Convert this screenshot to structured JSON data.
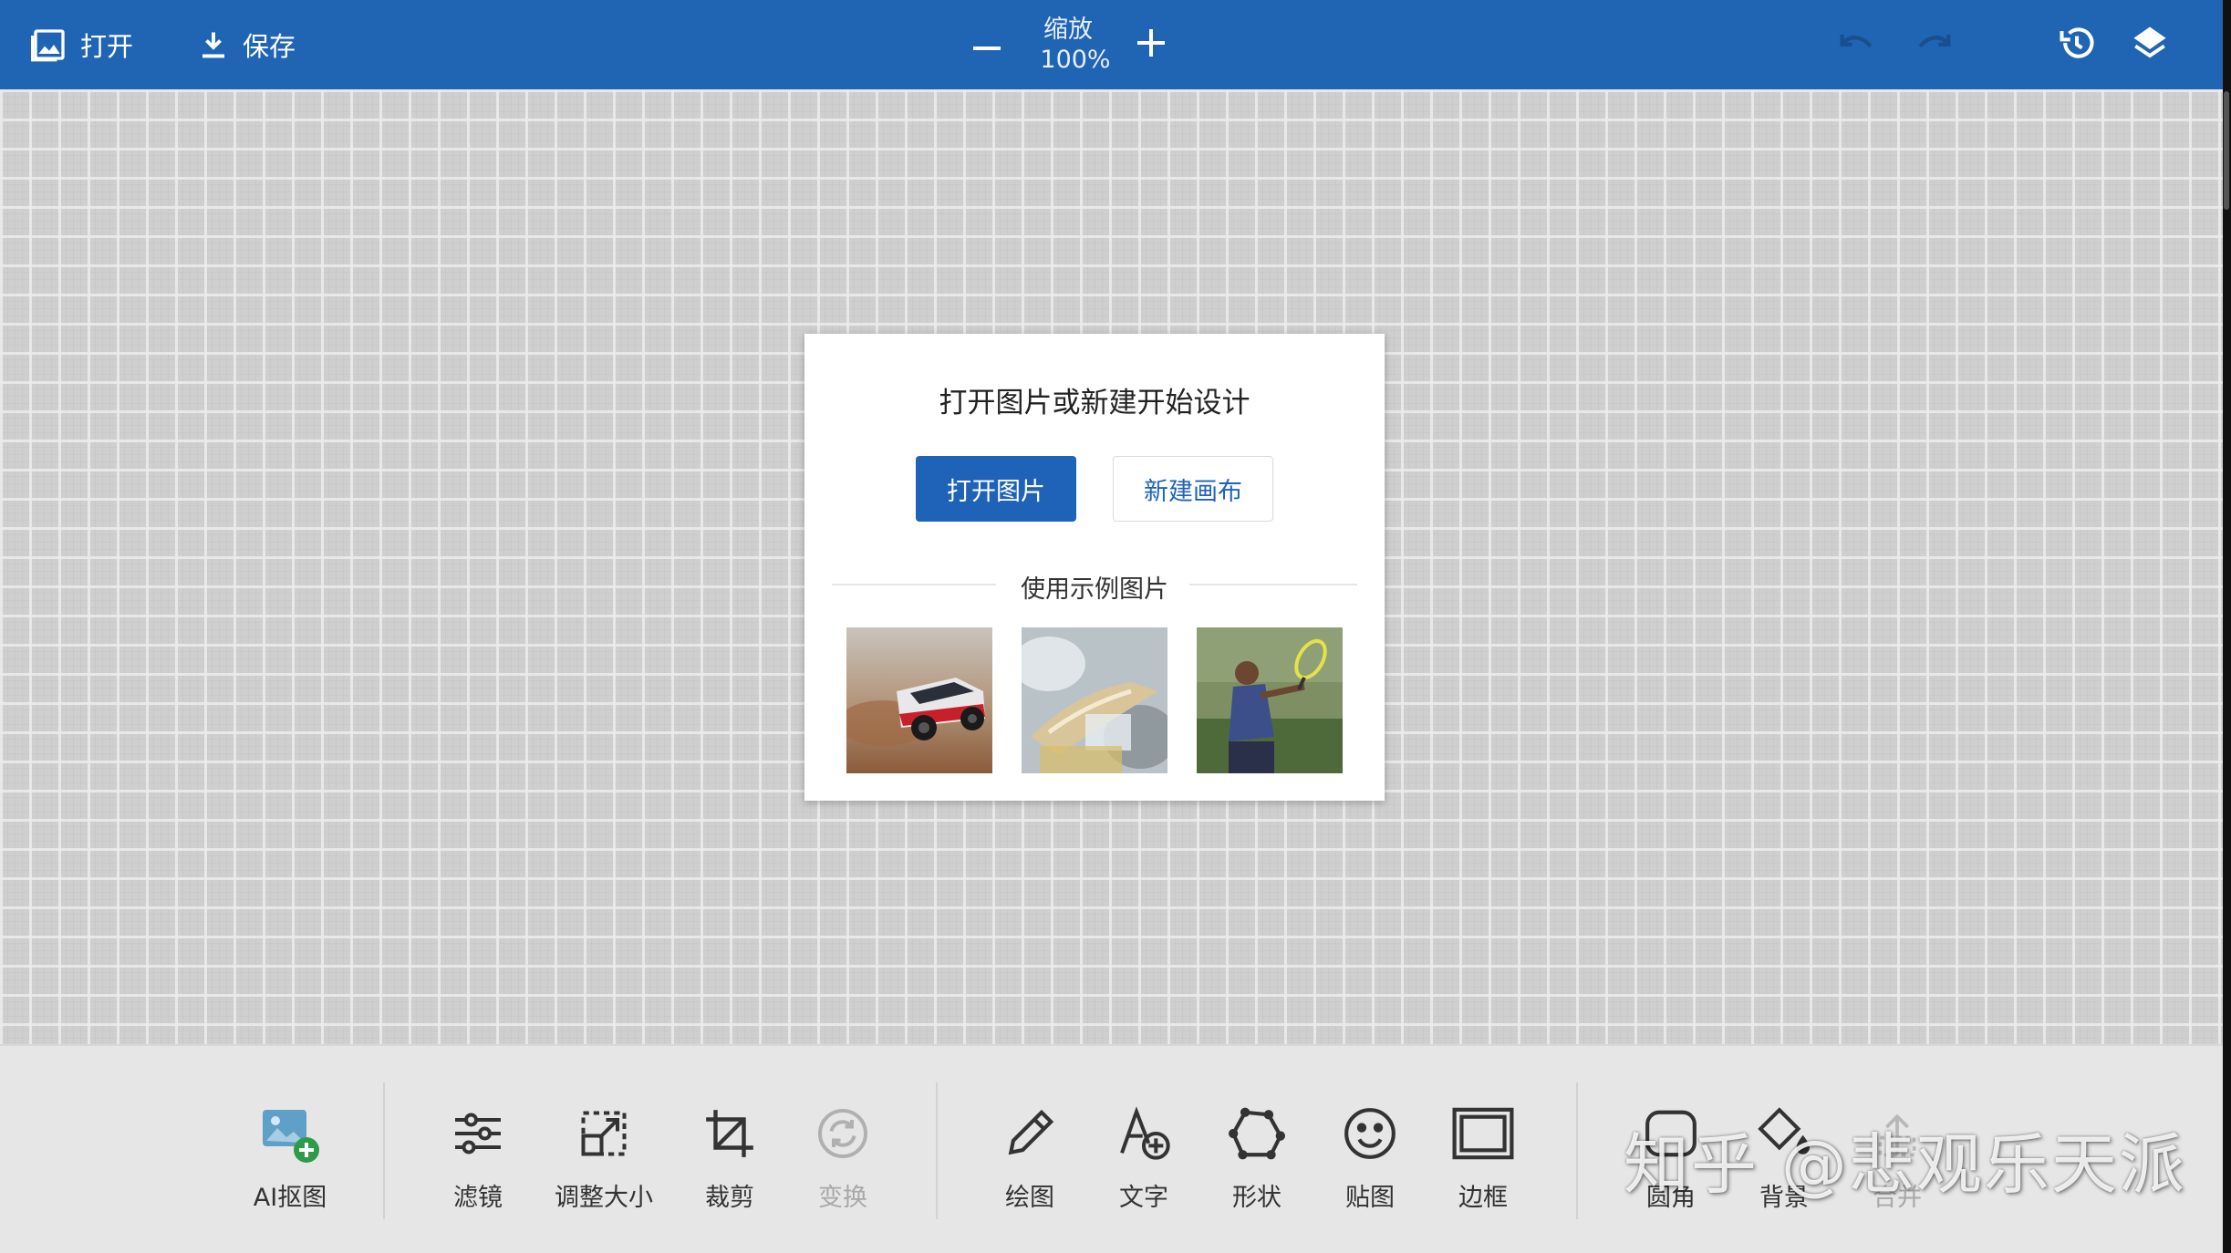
{
  "topbar": {
    "open_label": "打开",
    "save_label": "保存",
    "zoom_label": "缩放",
    "zoom_value": "100%",
    "accent_color": "#2065b4"
  },
  "dialog": {
    "title": "打开图片或新建开始设计",
    "open_image_label": "打开图片",
    "new_canvas_label": "新建画布",
    "sample_label": "使用示例图片",
    "samples": [
      "rally-car-photo",
      "glass-bottle-photo",
      "tennis-player-photo"
    ]
  },
  "toolbar": {
    "tools": [
      {
        "label": "AI抠图",
        "icon": "ai-cutout-icon",
        "enabled": true
      },
      {
        "label": "滤镜",
        "icon": "sliders-icon",
        "enabled": true
      },
      {
        "label": "调整大小",
        "icon": "resize-icon",
        "enabled": true
      },
      {
        "label": "裁剪",
        "icon": "crop-icon",
        "enabled": true
      },
      {
        "label": "变换",
        "icon": "transform-icon",
        "enabled": false
      },
      {
        "label": "绘图",
        "icon": "pencil-icon",
        "enabled": true
      },
      {
        "label": "文字",
        "icon": "text-icon",
        "enabled": true
      },
      {
        "label": "形状",
        "icon": "shape-icon",
        "enabled": true
      },
      {
        "label": "贴图",
        "icon": "sticker-icon",
        "enabled": true
      },
      {
        "label": "边框",
        "icon": "frame-icon",
        "enabled": true
      },
      {
        "label": "圆角",
        "icon": "rounded-corner-icon",
        "enabled": true
      },
      {
        "label": "背景",
        "icon": "background-icon",
        "enabled": true
      },
      {
        "label": "合并",
        "icon": "merge-icon",
        "enabled": false
      }
    ]
  },
  "watermark": "知乎 @悲观乐天派"
}
